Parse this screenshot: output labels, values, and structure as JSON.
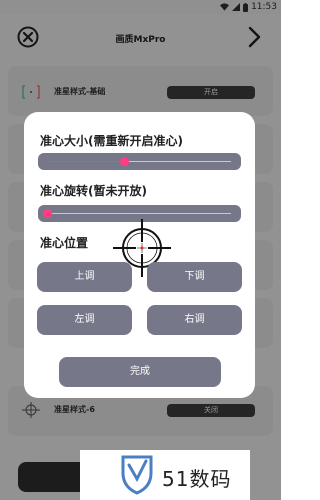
{
  "status_bar": {
    "time": "11:53",
    "icons": [
      "wifi-icon",
      "signal-icon",
      "battery-icon"
    ]
  },
  "header": {
    "title": "画质MxPro",
    "close_icon": "close-circle-icon",
    "next_icon": "chevron-right-icon"
  },
  "background_list": {
    "rows": [
      {
        "label": "准星样式-基础",
        "toggle": "开启"
      },
      {
        "label": "准星样式-6",
        "toggle": "关闭"
      }
    ]
  },
  "dialog": {
    "size_title": "准心大小(需重新开启准心)",
    "size_value": 0.42,
    "rotation_title": "准心旋转(暂未开放)",
    "rotation_value": 0.0,
    "position_title": "准心位置",
    "buttons": {
      "up": "上调",
      "down": "下调",
      "left": "左调",
      "right": "右调"
    },
    "done": "完成"
  },
  "watermark": {
    "text": "51数码"
  },
  "colors": {
    "accent": "#ff3d7f",
    "button": "#767789",
    "toggle": "#3f3f3f",
    "overlay": "rgba(0,0,0,0.40)"
  }
}
